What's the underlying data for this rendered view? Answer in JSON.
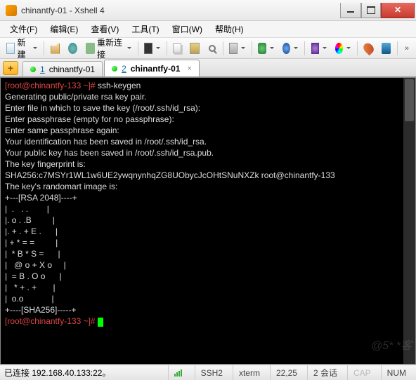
{
  "window": {
    "title": "chinantfy-01 - Xshell 4"
  },
  "menu": {
    "file": "文件(F)",
    "edit": "编辑(E)",
    "view": "查看(V)",
    "tools": "工具(T)",
    "window": "窗口(W)",
    "help": "帮助(H)"
  },
  "toolbar": {
    "new_label": "新建",
    "reconnect_label": "重新连接"
  },
  "tabs": {
    "items": [
      {
        "num": "1",
        "label": "chinantfy-01"
      },
      {
        "num": "2",
        "label": "chinantfy-01"
      }
    ],
    "active_index": 1
  },
  "terminal": {
    "prompt1_a": "[root@chinantfy-133 ~]# ",
    "cmd1": "ssh-keygen",
    "lines": [
      "Generating public/private rsa key pair.",
      "Enter file in which to save the key (/root/.ssh/id_rsa):",
      "Enter passphrase (empty for no passphrase):",
      "Enter same passphrase again:",
      "Your identification has been saved in /root/.ssh/id_rsa.",
      "Your public key has been saved in /root/.ssh/id_rsa.pub.",
      "The key fingerprint is:",
      "SHA256:c7MSYr1WL1w6UE2ywqnynhqZG8UObycJcOHtSNuNXZk root@chinantfy-133",
      "The key's randomart image is:",
      "+---[RSA 2048]----+",
      "|  .   . .        |",
      "|. o . .B         |",
      "|. + . + E .      |",
      "| + * = =         |",
      "|  * B * S =      |",
      "|   @ o + X o     |",
      "|  = B . O o      |",
      "|   * + . +       |",
      "|  o.o            |",
      "+----[SHA256]-----+"
    ],
    "prompt2": "[root@chinantfy-133 ~]# "
  },
  "status": {
    "connected": "已连接 192.168.40.133:22。",
    "proto": "SSH2",
    "term": "xterm",
    "pos": "22,25",
    "sess": "2 会话",
    "cap": "CAP",
    "num": "NUM"
  },
  "watermark": "@5*        *客"
}
